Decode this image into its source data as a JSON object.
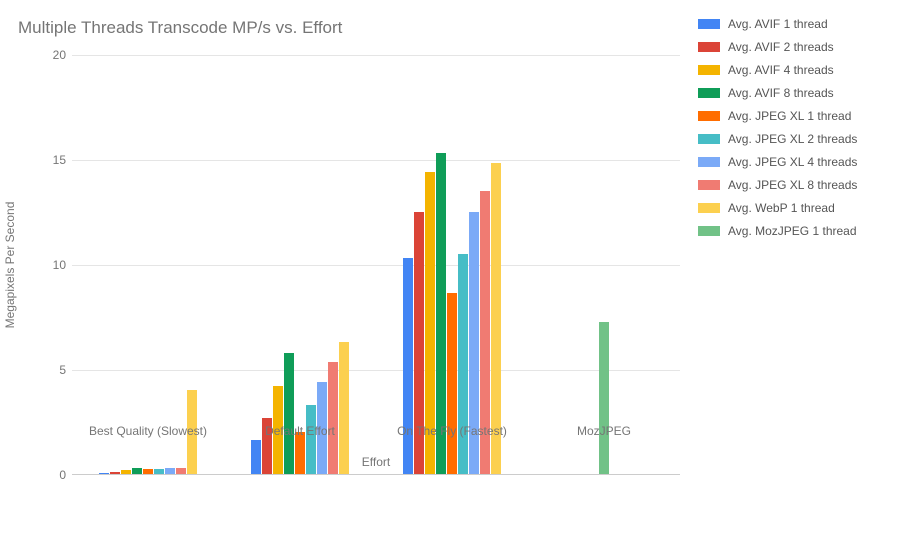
{
  "chart_data": {
    "type": "bar",
    "title": "Multiple Threads Transcode MP/s vs. Effort",
    "xlabel": "Effort",
    "ylabel": "Megapixels Per Second",
    "ylim": [
      0,
      20
    ],
    "yticks": [
      0,
      5,
      10,
      15,
      20
    ],
    "categories": [
      "Best Quality (Slowest)",
      "Default Effort",
      "On The Fly (Fastest)",
      "MozJPEG"
    ],
    "series": [
      {
        "name": "Avg. AVIF 1 thread",
        "color": "#4285F4",
        "values": [
          0.05,
          1.6,
          10.3,
          null
        ]
      },
      {
        "name": "Avg. AVIF 2 threads",
        "color": "#DB4437",
        "values": [
          0.1,
          2.65,
          12.5,
          null
        ]
      },
      {
        "name": "Avg. AVIF 4 threads",
        "color": "#F4B400",
        "values": [
          0.2,
          4.2,
          14.4,
          null
        ]
      },
      {
        "name": "Avg. AVIF 8 threads",
        "color": "#0F9D58",
        "values": [
          0.3,
          5.75,
          15.3,
          null
        ]
      },
      {
        "name": "Avg. JPEG XL 1 thread",
        "color": "#FF6D00",
        "values": [
          0.25,
          2.0,
          8.6,
          null
        ]
      },
      {
        "name": "Avg. JPEG XL 2 threads",
        "color": "#46BDC6",
        "values": [
          0.25,
          3.3,
          10.5,
          null
        ]
      },
      {
        "name": "Avg. JPEG XL 4 threads",
        "color": "#7BAAF7",
        "values": [
          0.3,
          4.4,
          12.5,
          null
        ]
      },
      {
        "name": "Avg. JPEG XL 8 threads",
        "color": "#F07B72",
        "values": [
          0.3,
          5.35,
          13.5,
          null
        ]
      },
      {
        "name": "Avg. WebP 1 thread",
        "color": "#FCD04F",
        "values": [
          4.0,
          6.3,
          14.8,
          null
        ]
      },
      {
        "name": "Avg. MozJPEG 1 thread",
        "color": "#71C287",
        "values": [
          null,
          null,
          null,
          7.25
        ]
      }
    ]
  }
}
